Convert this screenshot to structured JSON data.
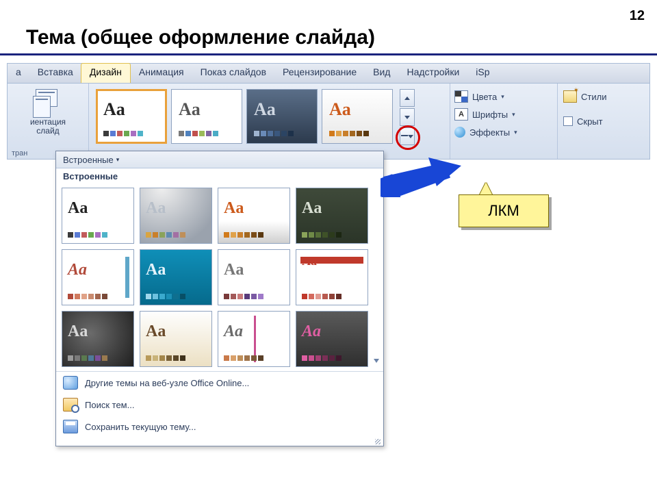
{
  "page_number": "12",
  "title": "Тема (общее оформление слайда)",
  "ribbon": {
    "tabs": [
      "а",
      "Вставка",
      "Дизайн",
      "Анимация",
      "Показ слайдов",
      "Рецензирование",
      "Вид",
      "Надстройки",
      "iSp"
    ],
    "activeTabIndex": 2,
    "orientation": {
      "label_line1": "иентация",
      "label_line2": "слайд",
      "group_footer": "тран"
    },
    "themeOptions": {
      "colors": "Цвета",
      "fonts": "Шрифты",
      "effects": "Эффекты"
    },
    "background": {
      "styles": "Стили",
      "hide": "Скрыт"
    }
  },
  "themesRow": [
    {
      "bg": "#ffffff",
      "aaColor": "#222222",
      "bars": [
        "#3b3b3b",
        "#5a7bd4",
        "#c25b5b",
        "#6aa84f",
        "#a96fc1",
        "#4fb3c9"
      ],
      "selected": true
    },
    {
      "bg": "#ffffff",
      "aaColor": "#555555",
      "bars": [
        "#7a7a7a",
        "#4f81bd",
        "#c0504d",
        "#9bbb59",
        "#8064a2",
        "#4bacc6"
      ],
      "selected": false
    },
    {
      "bg": "linear-gradient(#5a6e88,#2c3a4d)",
      "aaColor": "#cfd7e2",
      "bars": [
        "#9fb4cf",
        "#6a8bb8",
        "#4f6f9a",
        "#3a577d",
        "#2b4463",
        "#1d314a"
      ],
      "selected": false
    },
    {
      "bg": "linear-gradient(#ffffff,#e8e8e8)",
      "aaColor": "#cc5a1b",
      "bars": [
        "#d17a1b",
        "#e0a24a",
        "#c97f2b",
        "#a3671f",
        "#7a4c17",
        "#5a3810"
      ],
      "selected": false
    }
  ],
  "gallery": {
    "header": "Встроенные",
    "subheader": "Встроенные",
    "themes": [
      {
        "bg": "#ffffff",
        "aaColor": "#222222",
        "bars": [
          "#3b3b3b",
          "#5a7bd4",
          "#c25b5b",
          "#6aa84f",
          "#a96fc1",
          "#4fb3c9"
        ]
      },
      {
        "bg": "radial-gradient(circle at 30% 0%,#eeeeee,#9aa2ad 80%)",
        "aaColor": "#b7bfc9",
        "bars": [
          "#d9a441",
          "#c97f2b",
          "#8aa35a",
          "#5f8bb0",
          "#a36fa3",
          "#bf8f5a"
        ]
      },
      {
        "bg": "linear-gradient(#ffffff 60%,#cfcfcf)",
        "aaColor": "#cc5a1b",
        "bars": [
          "#d17a1b",
          "#e0a24a",
          "#c97f2b",
          "#a3671f",
          "#7a4c17",
          "#5a3810"
        ]
      },
      {
        "bg": "linear-gradient(#3f4a3a,#2b3528)",
        "aaColor": "#d8dfd3",
        "bars": [
          "#8aa35a",
          "#6f8a47",
          "#566e37",
          "#3f5228",
          "#2c3b1c",
          "#1c2712"
        ]
      },
      {
        "bg": "#ffffff",
        "aaColor": "#b14a3a",
        "aaFont": "italic",
        "accent": {
          "type": "rbar",
          "color": "#5fa7c9"
        },
        "bars": [
          "#b14a3a",
          "#d07a5e",
          "#e0a287",
          "#c98a6f",
          "#a3664f",
          "#7a4a38"
        ]
      },
      {
        "bg": "linear-gradient(#0f8fb8,#066a8c)",
        "aaColor": "#e4f3fb",
        "bars": [
          "#9fd7ec",
          "#6ec1de",
          "#3aa9cd",
          "#1b8fb5",
          "#0f6f8f",
          "#084f66"
        ]
      },
      {
        "bg": "#ffffff",
        "aaColor": "#777777",
        "bars": [
          "#7a3b3b",
          "#a35a5a",
          "#c97a7a",
          "#5a3b7a",
          "#7a5aa3",
          "#9f7ac9"
        ]
      },
      {
        "bg": "#ffffff",
        "aaColor": "#c0392b",
        "accent": {
          "type": "tbar",
          "color": "#c0392b"
        },
        "bars": [
          "#c0392b",
          "#d46a5e",
          "#e09a91",
          "#b85a4f",
          "#8f4238",
          "#662e27"
        ]
      },
      {
        "bg": "radial-gradient(circle at 40% 40%,#6b6b6b,#1f1f1f)",
        "aaColor": "#d9d9d9",
        "bars": [
          "#9a9a9a",
          "#7a7a7a",
          "#5a7a4f",
          "#4f7a9a",
          "#7a4f9a",
          "#9a7a4f"
        ]
      },
      {
        "bg": "linear-gradient(#fefefe,#ece0c3)",
        "aaColor": "#6a4a2a",
        "bars": [
          "#b89a5a",
          "#c9b37a",
          "#a3864a",
          "#7a6238",
          "#5a4728",
          "#3f321c"
        ]
      },
      {
        "bg": "#ffffff",
        "aaColor": "#6a6a6a",
        "aaFont": "italic",
        "accent": {
          "type": "vstripe",
          "color": "#c94f8f"
        },
        "bars": [
          "#c97a4a",
          "#d9a06a",
          "#bf8f5a",
          "#9f734a",
          "#7a5838",
          "#5a4028"
        ]
      },
      {
        "bg": "linear-gradient(#5a5a5a,#2f2f2f)",
        "aaColor": "#e05fa3",
        "aaFont": "italic",
        "bars": [
          "#e05fa3",
          "#c94f8f",
          "#a33f73",
          "#7a2f56",
          "#5a2240",
          "#3f182d"
        ]
      }
    ],
    "footer": {
      "online": "Другие темы на веб-узле Office Online...",
      "browse": "Поиск тем...",
      "save": "Сохранить текущую тему..."
    }
  },
  "callout": "ЛКМ"
}
